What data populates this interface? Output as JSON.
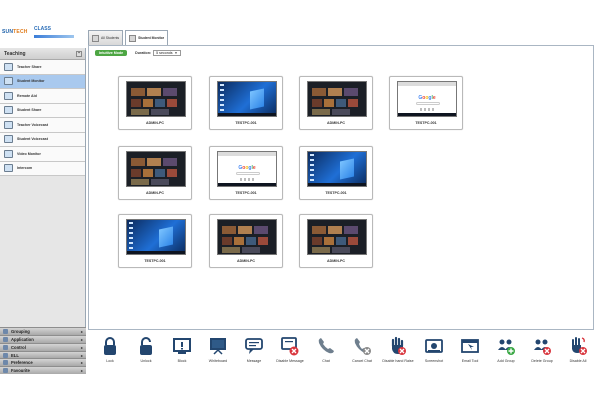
{
  "header": {
    "logo_left": "SUN",
    "logo_left_accent": "TECH",
    "logo_right": "CLASS"
  },
  "tabs": [
    {
      "label": "All Students",
      "active": false
    },
    {
      "label": "Student Monitor",
      "active": true
    }
  ],
  "sidebar": {
    "section_title": "Teaching",
    "items": [
      {
        "label": "Teacher Share",
        "icon": "monitor-share-icon",
        "active": false
      },
      {
        "label": "Student Monitor",
        "icon": "student-monitor-icon",
        "active": true
      },
      {
        "label": "Remote Aid",
        "icon": "remote-aid-icon",
        "active": false
      },
      {
        "label": "Student Share",
        "icon": "student-share-icon",
        "active": false
      },
      {
        "label": "Teacher Voicecast",
        "icon": "teacher-voicecast-icon",
        "active": false
      },
      {
        "label": "Student Voicecast",
        "icon": "student-voicecast-icon",
        "active": false
      },
      {
        "label": "Video Monitor",
        "icon": "video-monitor-icon",
        "active": false
      },
      {
        "label": "Intercom",
        "icon": "intercom-icon",
        "active": false
      }
    ],
    "categories": [
      {
        "label": "Grouping"
      },
      {
        "label": "Application"
      },
      {
        "label": "Control"
      },
      {
        "label": "ELL"
      },
      {
        "label": "Preference"
      },
      {
        "label": "Favourite"
      }
    ]
  },
  "main": {
    "mode_button": "Intuitive Mode",
    "duration_label": "Duration:",
    "duration_value": "5 seconds",
    "thumbnails": [
      {
        "caption": "ADMIN-PC",
        "screen": "dark"
      },
      {
        "caption": "TESTPC-001",
        "screen": "win"
      },
      {
        "caption": "ADMIN-PC",
        "screen": "dark"
      },
      {
        "caption": "TESTPC-001",
        "screen": "google"
      },
      {
        "caption": "ADMIN-PC",
        "screen": "dark"
      },
      {
        "caption": "TESTPC-001",
        "screen": "google"
      },
      {
        "caption": "TESTPC-001",
        "screen": "win"
      },
      {
        "caption": "TESTPC-001",
        "screen": "win"
      },
      {
        "caption": "ADMIN-PC",
        "screen": "dark"
      },
      {
        "caption": "ADMIN-PC",
        "screen": "dark"
      }
    ]
  },
  "toolbar": [
    {
      "label": "Lock",
      "icon": "lock-icon"
    },
    {
      "label": "Unlock",
      "icon": "unlock-icon"
    },
    {
      "label": "Block",
      "icon": "block-icon"
    },
    {
      "label": "Whiteboard",
      "icon": "whiteboard-icon"
    },
    {
      "label": "Message",
      "icon": "message-icon"
    },
    {
      "label": "Disable Message",
      "icon": "disable-message-icon"
    },
    {
      "label": "Chat",
      "icon": "chat-icon"
    },
    {
      "label": "Cancel Chat",
      "icon": "cancel-chat-icon"
    },
    {
      "label": "Disable hand Raise",
      "icon": "disable-hand-raise-icon"
    },
    {
      "label": "Screenshot",
      "icon": "screenshot-icon"
    },
    {
      "label": "Email Tool",
      "icon": "email-tool-icon"
    },
    {
      "label": "Add Group",
      "icon": "add-group-icon"
    },
    {
      "label": "Delete Group",
      "icon": "delete-group-icon"
    },
    {
      "label": "Disable All",
      "icon": "disable-all-icon"
    }
  ],
  "colors": {
    "accent_blue": "#23466f",
    "mode_green": "#4da643",
    "disable_red": "#d9363e",
    "add_green": "#3aa845",
    "selected_item": "#a9c9ee"
  }
}
